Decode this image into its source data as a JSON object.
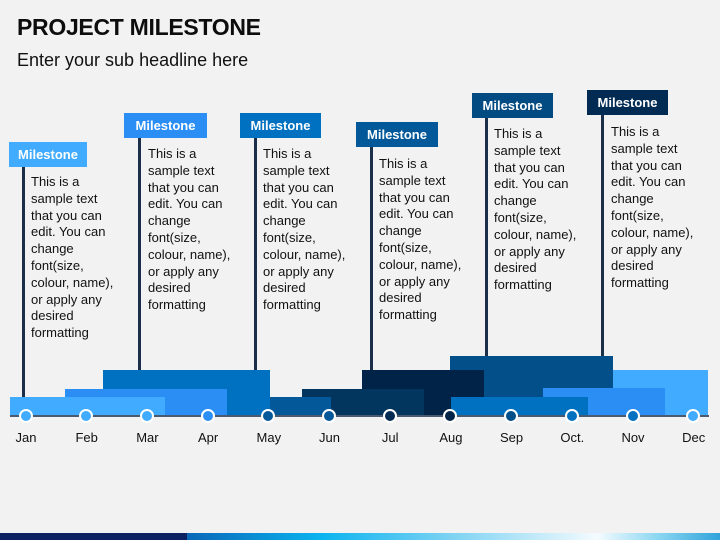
{
  "header": {
    "title": "PROJECT MILESTONE",
    "subtitle": "Enter your sub headline here"
  },
  "colors": {
    "light_blue": "#41abff",
    "mid_blue": "#2a8ef5",
    "blue": "#0070c0",
    "steel_blue": "#03589a",
    "deep_blue": "#024f8a",
    "navy": "#02365f",
    "dark_navy": "#022348",
    "pole": "#1b2f4a",
    "background": "#f2f2f2"
  },
  "milestones": [
    {
      "label": "Milestone",
      "text": "This is a\nsample text\nthat you can\nedit. You can\nchange\nfont(size,\ncolour, name),\nor apply any\ndesired\nformatting",
      "color": "#41abff"
    },
    {
      "label": "Milestone",
      "text": "This is a\nsample text\nthat you can\nedit. You can\nchange\nfont(size,\ncolour, name),\nor apply any\ndesired\nformatting",
      "color": "#2a8ef5"
    },
    {
      "label": "Milestone",
      "text": "This is a\nsample text\nthat you can\nedit. You can\nchange\nfont(size,\ncolour, name),\nor apply any\ndesired\nformatting",
      "color": "#0070c0"
    },
    {
      "label": "Milestone",
      "text": "This is a\nsample text\nthat you can\nedit. You can\nchange\nfont(size,\ncolour, name),\nor apply any\ndesired\nformatting",
      "color": "#03589a"
    },
    {
      "label": "Milestone",
      "text": "This is a\nsample text\nthat you can\nedit. You can\nchange\nfont(size,\ncolour, name),\nor apply any\ndesired\nformatting",
      "color": "#024a82"
    },
    {
      "label": "Milestone",
      "text": "This is a\nsample text\nthat you can\nedit. You can\nchange\nfont(size,\ncolour, name),\nor apply any\ndesired\nformatting",
      "color": "#022b54"
    }
  ],
  "timeline": {
    "months": [
      "Jan",
      "Feb",
      "Mar",
      "Apr",
      "May",
      "Jun",
      "Jul",
      "Aug",
      "Sep",
      "Oct.",
      "Nov",
      "Dec"
    ],
    "dot_colors": [
      "#41abff",
      "#41abff",
      "#41abff",
      "#2a8ef5",
      "#03589a",
      "#03589a",
      "#022b54",
      "#022348",
      "#024f8a",
      "#0070c0",
      "#0070c0",
      "#41abff"
    ]
  }
}
